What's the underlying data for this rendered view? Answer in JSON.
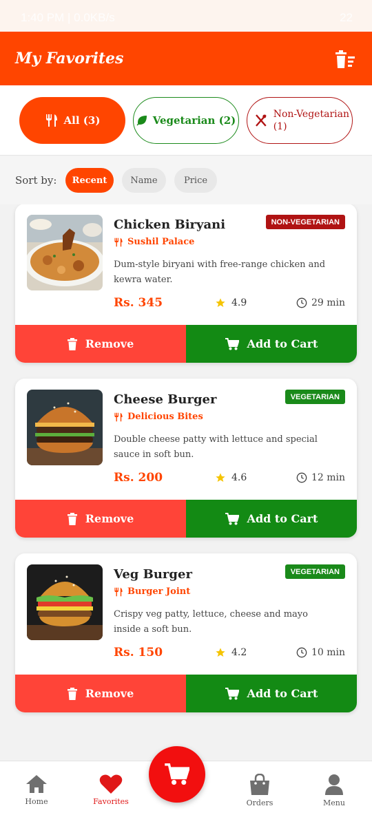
{
  "status_bar": {
    "left": "1:40 PM | 0.0KB/s",
    "right": "22"
  },
  "app_bar": {
    "title": "My Favorites",
    "clear_icon": "clear-all-icon"
  },
  "filters": [
    {
      "label": "All (3)",
      "icon": "utensils-icon",
      "active": true
    },
    {
      "label": "Vegetarian (2)",
      "icon": "leaf-icon",
      "active": false
    },
    {
      "label": "Non-Vegetarian (1)",
      "icon": "no-food-icon",
      "active": false
    }
  ],
  "sort": {
    "label": "Sort by:",
    "options": [
      "Recent",
      "Name",
      "Price"
    ],
    "selected": "Recent"
  },
  "items": [
    {
      "name": "Chicken Biryani",
      "badge": "NON-VEGETARIAN",
      "restaurant": "Sushil Palace",
      "description": "Dum-style biryani with free-range chicken and kewra water.",
      "price": "Rs. 345",
      "rating": "4.9",
      "time": "29 min",
      "remove_label": "Remove",
      "cart_label": "Add to Cart"
    },
    {
      "name": "Cheese Burger",
      "badge": "VEGETARIAN",
      "restaurant": "Delicious Bites",
      "description": "Double cheese patty with lettuce and special sauce in soft bun.",
      "price": "Rs. 200",
      "rating": "4.6",
      "time": "12 min",
      "remove_label": "Remove",
      "cart_label": "Add to Cart"
    },
    {
      "name": "Veg Burger",
      "badge": "VEGETARIAN",
      "restaurant": "Burger Joint",
      "description": "Crispy veg patty, lettuce, cheese and mayo inside a soft bun.",
      "price": "Rs. 150",
      "rating": "4.2",
      "time": "10 min",
      "remove_label": "Remove",
      "cart_label": "Add to Cart"
    }
  ],
  "bottom_nav": [
    {
      "label": "Home",
      "icon": "home-icon"
    },
    {
      "label": "Favorites",
      "icon": "heart-icon",
      "active": true
    },
    {
      "label": "Orders",
      "icon": "shopping-bag-icon"
    },
    {
      "label": "Menu",
      "icon": "person-icon"
    }
  ],
  "colors": {
    "primary": "#ff4500",
    "veg": "#1a8a1a",
    "nonveg": "#b01313",
    "remove": "#ff4438",
    "cart": "#138a14"
  }
}
